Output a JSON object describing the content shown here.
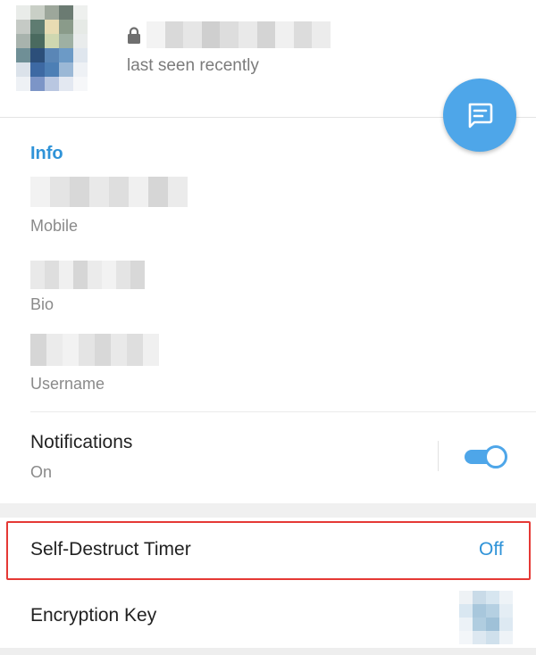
{
  "header": {
    "status": "last seen recently",
    "avatar_colors": [
      "#e9ece9",
      "#c9cfc6",
      "#9da79b",
      "#6b7b72",
      "#eef0ee",
      "#c5cac5",
      "#5f7c71",
      "#e8dcb3",
      "#8a9b8a",
      "#e6eae6",
      "#a8b3ad",
      "#4a6a5f",
      "#cfd7b0",
      "#9eb0a3",
      "#e9ecec",
      "#6f8f96",
      "#2c4f7a",
      "#5a86b6",
      "#6c9ac6",
      "#dfe6ee",
      "#dbe2ea",
      "#3d69a3",
      "#4d7fb5",
      "#9bb8d6",
      "#eef1f5",
      "#eef1f5",
      "#7c95c7",
      "#b9c7e1",
      "#e3e8f1",
      "#f6f7f9"
    ],
    "name_blur_colors": [
      "#f3f3f3",
      "#d9d9d9",
      "#e6e6e6",
      "#cfcfcf",
      "#dddddd",
      "#e9e9e9",
      "#d4d4d4",
      "#f0f0f0",
      "#dcdcdc",
      "#ececec"
    ],
    "lock_icon": "lock-icon"
  },
  "fab": {
    "icon": "message-icon",
    "color": "#4ea6e9"
  },
  "info": {
    "title": "Info",
    "fields": [
      {
        "label": "Mobile"
      },
      {
        "label": "Bio"
      },
      {
        "label": "Username"
      }
    ],
    "blur_colors": [
      "#f2f2f2",
      "#e4e4e4",
      "#d8d8d8",
      "#e9e9e9",
      "#dedede",
      "#f0f0f0",
      "#d6d6d6",
      "#ebebeb"
    ]
  },
  "notifications": {
    "title": "Notifications",
    "subtitle": "On",
    "enabled": true
  },
  "self_destruct": {
    "label": "Self-Destruct Timer",
    "value": "Off"
  },
  "encryption": {
    "label": "Encryption Key",
    "key_colors": [
      "#eef2f5",
      "#c9dbe8",
      "#d7e6f0",
      "#eef3f7",
      "#d9e7f1",
      "#a8c7dc",
      "#b5d0e2",
      "#e4edf4",
      "#ecf2f7",
      "#b0cde0",
      "#9fc1d8",
      "#dde9f2",
      "#f3f6f9",
      "#dde8f1",
      "#cfe0ec",
      "#eef3f7"
    ]
  },
  "colors": {
    "accent": "#2f93d8",
    "highlight": "#e53935"
  }
}
